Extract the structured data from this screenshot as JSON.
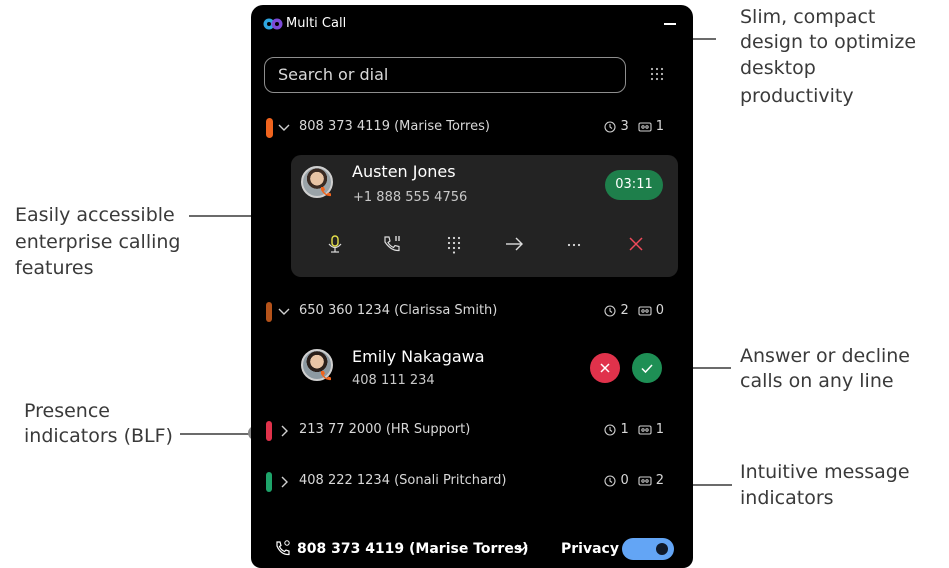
{
  "annotations": {
    "slim": [
      "Slim, compact",
      "design to optimize",
      "desktop",
      "productivity"
    ],
    "features": [
      "Easily accessible",
      "enterprise calling",
      "features"
    ],
    "answer": [
      "Answer or decline",
      "calls on any line"
    ],
    "presence": [
      "Presence",
      "indicators (BLF)"
    ],
    "messages": [
      "Intuitive message",
      "indicators"
    ]
  },
  "app": {
    "title": "Multi Call",
    "search_placeholder": "Search or dial"
  },
  "lines": [
    {
      "label": "808 373 4119 (Marise Torres)",
      "indicator_color": "#f0641e",
      "expanded": true,
      "calls": "3",
      "messages": "1"
    },
    {
      "label": "650 360 1234 (Clarissa Smith)",
      "indicator_color": "#b5531a",
      "expanded": true,
      "calls": "2",
      "messages": "0"
    },
    {
      "label": "213 77 2000 (HR Support)",
      "indicator_color": "#e0324b",
      "expanded": false,
      "calls": "1",
      "messages": "1"
    },
    {
      "label": "408 222 1234 (Sonali Pritchard)",
      "indicator_color": "#1ea46a",
      "expanded": false,
      "calls": "0",
      "messages": "2"
    }
  ],
  "active_call": {
    "name": "Austen Jones",
    "number": "+1 888 555 4756",
    "timer": "03:11",
    "controls": [
      "microphone-icon",
      "hold-icon",
      "keypad-icon",
      "transfer-icon",
      "more-icon",
      "end-call-icon"
    ]
  },
  "incoming_call": {
    "name": "Emily Nakagawa",
    "number": "408 111 234"
  },
  "bottom_bar": {
    "selected_line": "808 373 4119 (Marise Torres)",
    "privacy_label": "Privacy",
    "privacy_on": true
  },
  "colors": {
    "accent_green": "#1e7f4b",
    "decline_red": "#e0324b",
    "answer_green": "#1e8f55",
    "toggle_blue": "#63a5f5"
  }
}
